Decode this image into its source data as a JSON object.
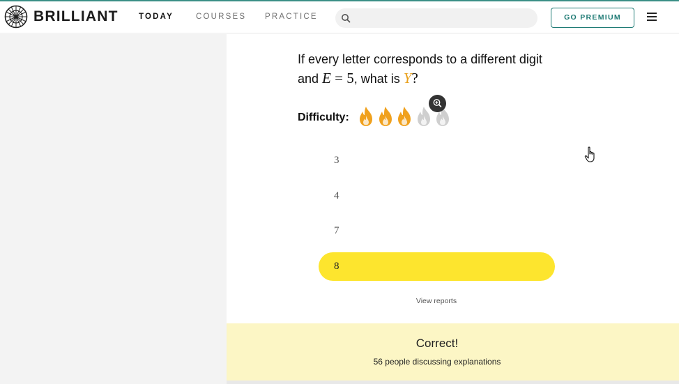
{
  "header": {
    "brand": "BRILLIANT",
    "nav": [
      {
        "label": "TODAY",
        "active": true
      },
      {
        "label": "COURSES",
        "active": false
      },
      {
        "label": "PRACTICE",
        "active": false
      }
    ],
    "search": {
      "placeholder": "",
      "icon": "search-icon"
    },
    "premium_label": "GO PREMIUM",
    "menu_icon": "hamburger-menu-icon",
    "accent_color": "#1e7a74"
  },
  "question": {
    "line1": "If every letter corresponds to a different digit",
    "line2_prefix": "and ",
    "math_var": "E",
    "math_eq": " = ",
    "math_num": "5",
    "line2_mid": ", what is ",
    "unknown": "Y",
    "line2_end": "?"
  },
  "difficulty": {
    "label": "Difficulty:",
    "level": 3,
    "max": 5,
    "active_color": "#f0a11e",
    "inactive_color": "#cfcfcf"
  },
  "options": [
    {
      "label": "3",
      "selected": false
    },
    {
      "label": "4",
      "selected": false
    },
    {
      "label": "7",
      "selected": false
    },
    {
      "label": "8",
      "selected": true
    }
  ],
  "view_reports": "View reports",
  "result": {
    "title": "Correct!",
    "subtitle": "56 people discussing explanations",
    "background": "#fcf6c5"
  }
}
